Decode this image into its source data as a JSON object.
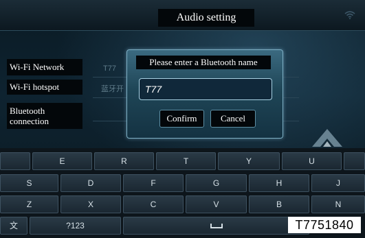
{
  "header": {
    "title": "Audio setting",
    "status_icon": "wifi-icon"
  },
  "sidebar": {
    "items": [
      {
        "label": "Wi-Fi Network"
      },
      {
        "label": "Wi-Fi hotspot"
      },
      {
        "label": "Bluetooth\nconnection"
      }
    ]
  },
  "background_values": {
    "row1": "T77",
    "row2": "蓝牙开"
  },
  "dialog": {
    "title": "Please enter a Bluetooth name",
    "input_value": "T77",
    "confirm_label": "Confirm",
    "cancel_label": "Cancel"
  },
  "keyboard": {
    "row1": [
      "E",
      "R",
      "T",
      "Y",
      "U"
    ],
    "row2": [
      "S",
      "D",
      "F",
      "G",
      "H",
      "J"
    ],
    "row3": [
      "Z",
      "X",
      "C",
      "V",
      "B",
      "N"
    ],
    "lang_key": "文",
    "numbers_key": "?123",
    "space_icon": "space-icon"
  },
  "watermark": "T7751840"
}
